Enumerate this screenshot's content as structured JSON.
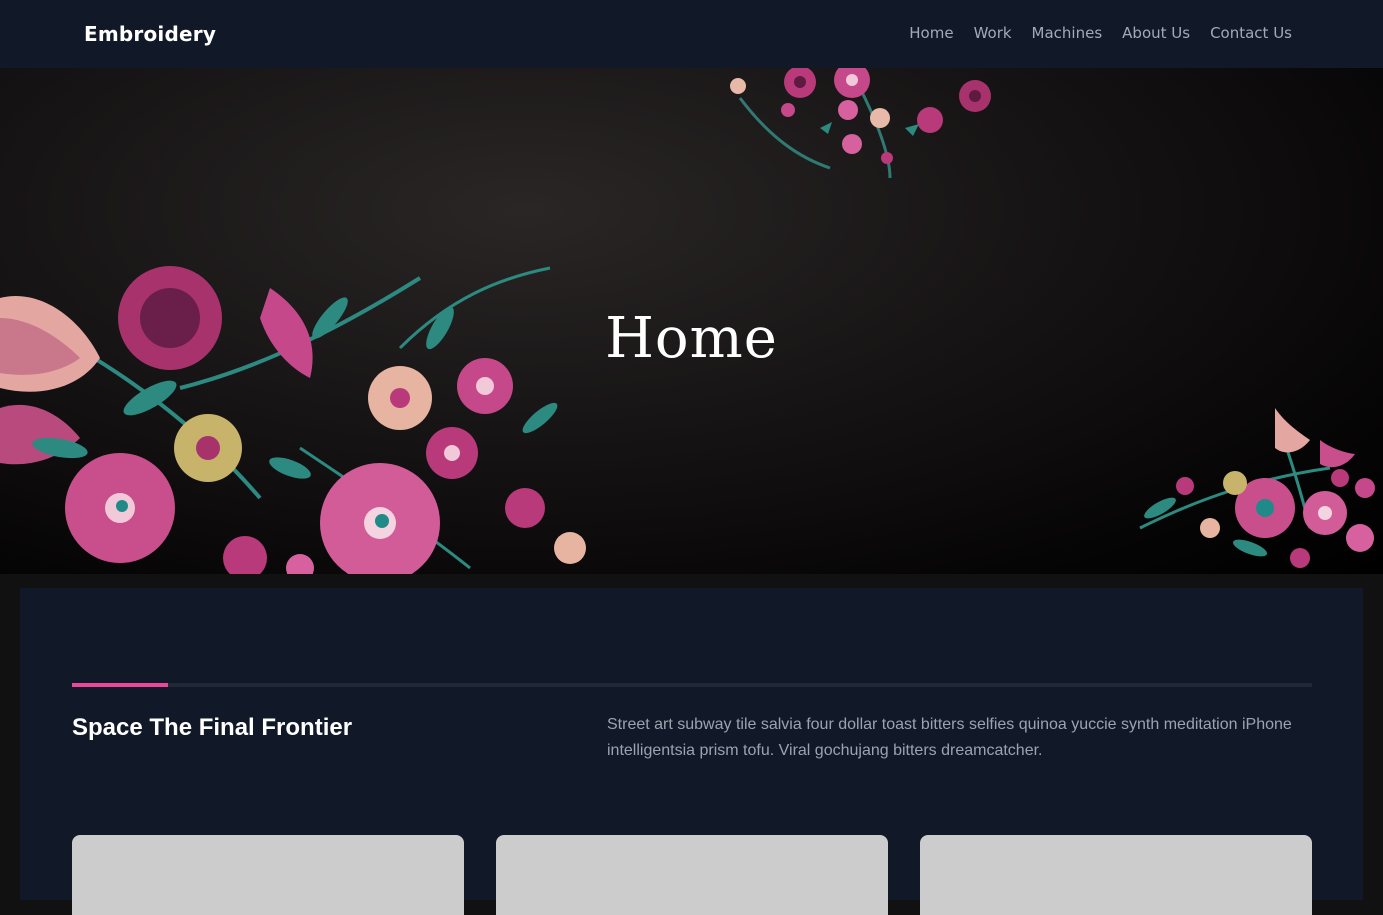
{
  "header": {
    "brand": "Embroidery",
    "nav": [
      "Home",
      "Work",
      "Machines",
      "About Us",
      "Contact Us"
    ]
  },
  "hero": {
    "title": "Home"
  },
  "section": {
    "title": "Space The Final Frontier",
    "text": "Street art subway tile salvia four dollar toast bitters selfies quinoa yuccie synth meditation iPhone intelligentsia prism tofu. Viral gochujang bitters dreamcatcher."
  },
  "colors": {
    "header_bg": "#111827",
    "accent": "#ec4899",
    "page_bg": "#111111",
    "card_bg": "#cccccc"
  }
}
